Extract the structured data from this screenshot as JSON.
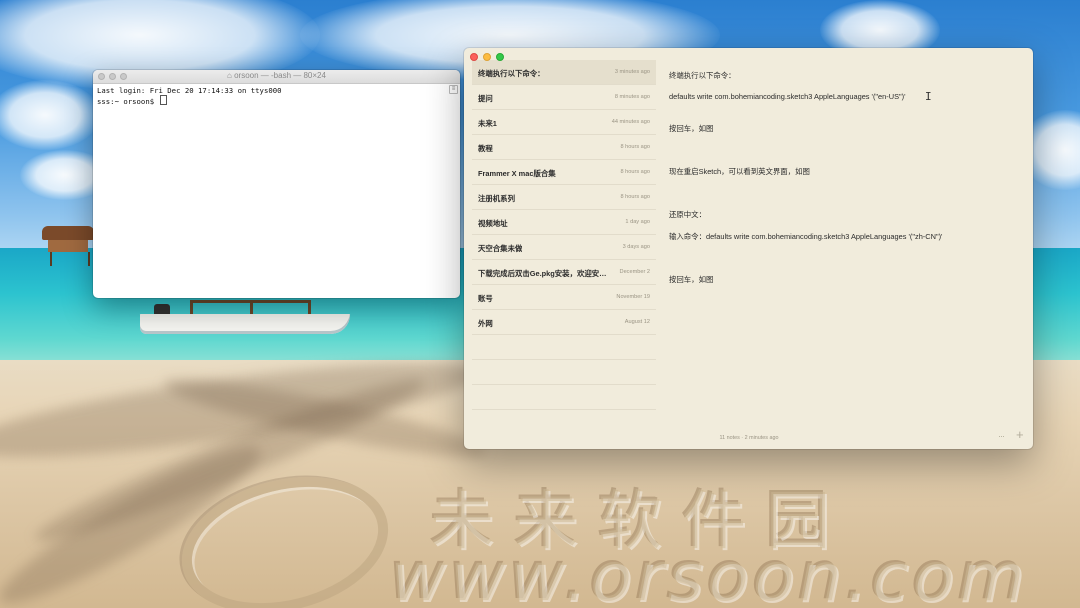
{
  "terminal": {
    "title": "orsoon — -bash — 80×24",
    "lines": [
      "Last login: Fri Dec 20 17:14:33 on ttys000",
      "sss:~ orsoon$ "
    ]
  },
  "notes": {
    "list": [
      {
        "title": "终端执行以下命令：",
        "time": "3 minutes ago"
      },
      {
        "title": "提问",
        "time": "8 minutes ago"
      },
      {
        "title": "未来1",
        "time": "44 minutes ago"
      },
      {
        "title": "教程",
        "time": "8 hours ago"
      },
      {
        "title": "Frammer X mac版合集",
        "time": "8 hours ago"
      },
      {
        "title": "注册机系列",
        "time": "8 hours ago"
      },
      {
        "title": "视频地址",
        "time": "1 day ago"
      },
      {
        "title": "天空合集未做",
        "time": "3 days ago"
      },
      {
        "title": "下载完成后双击Ge.pkg安装，欢迎安…",
        "time": "December 2"
      },
      {
        "title": "账号",
        "time": "November 19"
      },
      {
        "title": "外网",
        "time": "August 12"
      }
    ],
    "footer_status": "11 notes · 2 minutes ago",
    "footer_more": "···",
    "footer_add": "+",
    "editor": {
      "l1": "终端执行以下命令：",
      "l2": "defaults write com.bohemiancoding.sketch3 AppleLanguages '(\"en-US\")'",
      "l3": "按回车，如图",
      "l4": "现在重启Sketch，可以看到英文界面，如图",
      "l5": "还原中文：",
      "l6": "输入命令：defaults write com.bohemiancoding.sketch3 AppleLanguages '(\"zh-CN\")'",
      "l7": "按回车，如图"
    }
  },
  "wallpaper": {
    "watermark_cn": "未来软件园",
    "watermark_url": "www.orsoon.com"
  },
  "colors": {
    "notes_bg": "#f1ecdc",
    "selected_row": "#e5dfcd",
    "traffic_red": "#fc605c",
    "traffic_yellow": "#fdbc40",
    "traffic_green": "#34c84a"
  }
}
